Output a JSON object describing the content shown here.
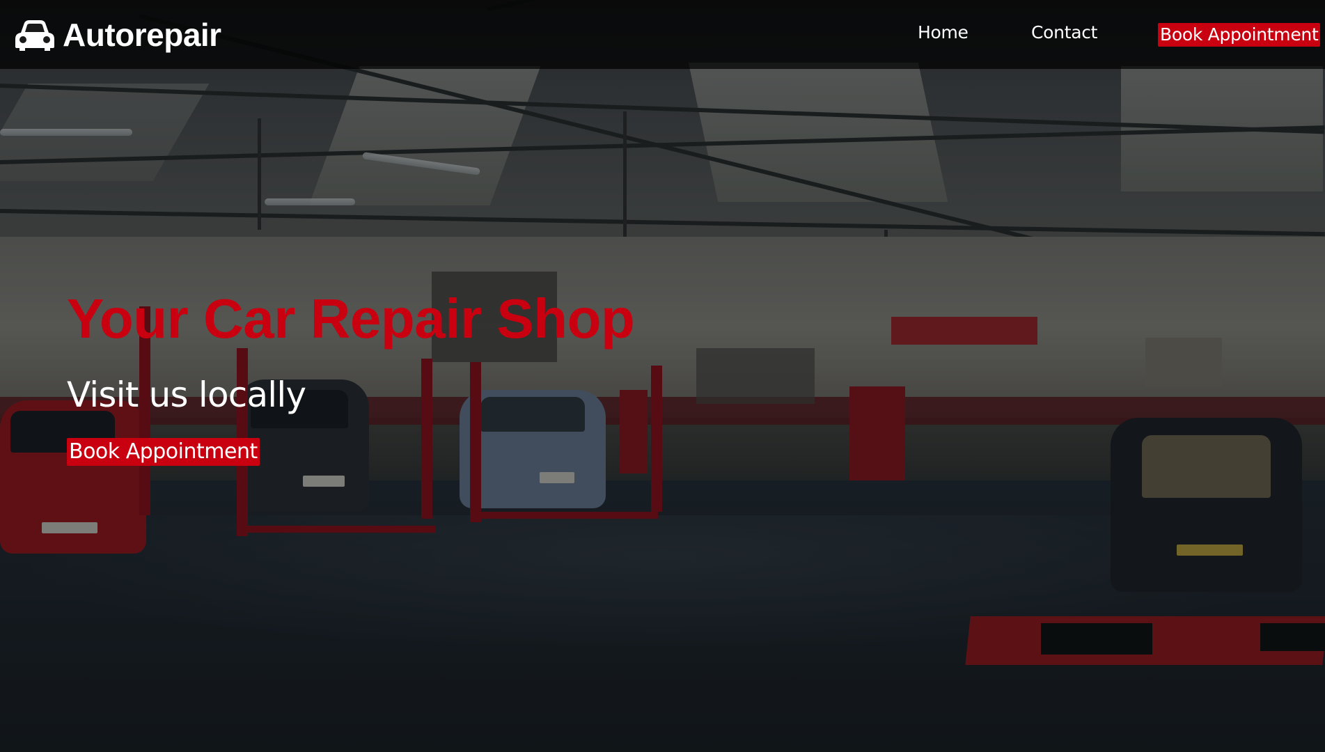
{
  "navbar": {
    "brand": {
      "name": "Autorepair",
      "icon": "car-icon"
    },
    "links": [
      {
        "label": "Home"
      },
      {
        "label": "Contact"
      }
    ],
    "cta_label": "Book Appointment"
  },
  "hero": {
    "title": "Your Car Repair Shop",
    "subtitle": "Visit us locally",
    "cta_label": "Book Appointment",
    "background": "car-repair-garage-photo"
  },
  "colors": {
    "accent": "#c8000f",
    "navbar_bg": "#000000",
    "text": "#ffffff"
  }
}
